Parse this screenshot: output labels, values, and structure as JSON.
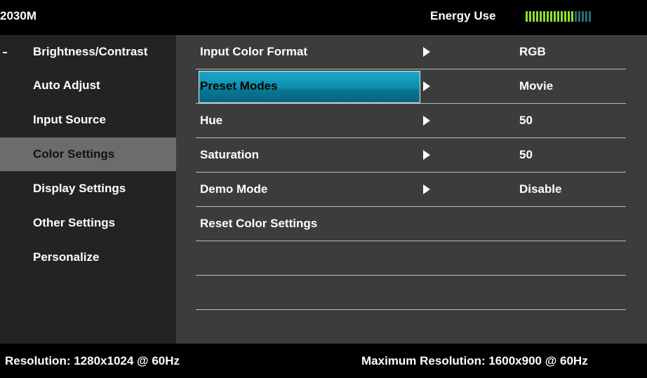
{
  "header": {
    "model": "2030M",
    "energy_label": "Energy Use",
    "energy_level": {
      "filled": 14,
      "total": 19
    }
  },
  "sidebar": {
    "items": [
      {
        "label": "Brightness/Contrast"
      },
      {
        "label": "Auto Adjust"
      },
      {
        "label": "Input Source"
      },
      {
        "label": "Color Settings",
        "active": true
      },
      {
        "label": "Display Settings"
      },
      {
        "label": "Other Settings"
      },
      {
        "label": "Personalize"
      }
    ]
  },
  "main": {
    "rows": [
      {
        "label": "Input Color Format",
        "value": "RGB"
      },
      {
        "label": "Preset Modes",
        "value": "Movie",
        "selected": true
      },
      {
        "label": "Hue",
        "value": "50"
      },
      {
        "label": "Saturation",
        "value": "50"
      },
      {
        "label": "Demo Mode",
        "value": "Disable"
      },
      {
        "label": "Reset Color Settings",
        "value": ""
      }
    ]
  },
  "footer": {
    "resolution": "Resolution: 1280x1024 @ 60Hz",
    "max_resolution": "Maximum Resolution: 1600x900 @ 60Hz"
  },
  "colors": {
    "highlight": "#0e8fae",
    "energy_on": "#8ee02e",
    "energy_off": "#2e6b78"
  }
}
